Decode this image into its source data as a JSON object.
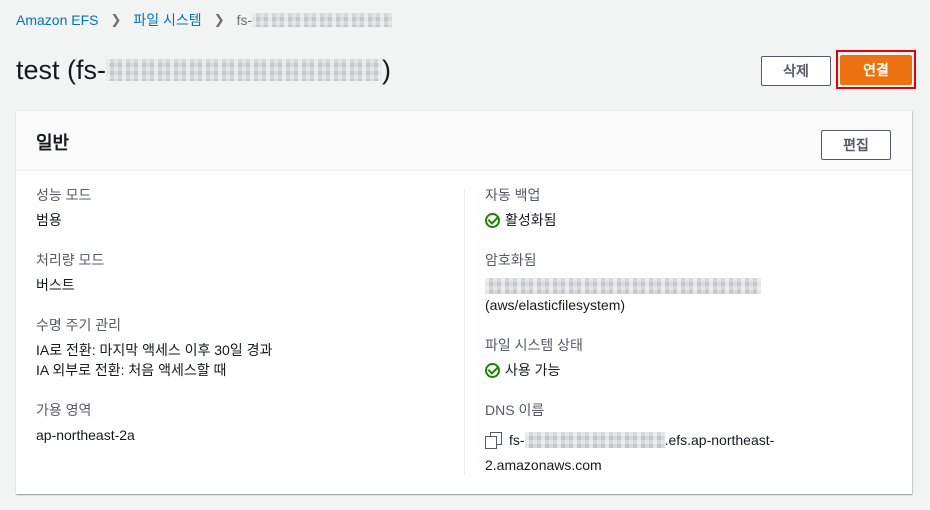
{
  "breadcrumb": {
    "items": [
      "Amazon EFS",
      "파일 시스템"
    ],
    "current": "fs-"
  },
  "title": {
    "prefix": "test (fs-",
    "suffix": ")"
  },
  "actions": {
    "delete": "삭제",
    "connect": "연결"
  },
  "panel": {
    "title": "일반",
    "edit": "편집"
  },
  "left": {
    "performance_label": "성능 모드",
    "performance_value": "범용",
    "throughput_label": "처리량 모드",
    "throughput_value": "버스트",
    "lifecycle_label": "수명 주기 관리",
    "lifecycle_line1": "IA로 전환: 마지막 액세스 이후 30일 경과",
    "lifecycle_line2": "IA 외부로 전환: 처음 액세스할 때",
    "az_label": "가용 영역",
    "az_value": "ap-northeast-2a"
  },
  "right": {
    "backup_label": "자동 백업",
    "backup_value": "활성화됨",
    "encrypted_label": "암호화됨",
    "encrypted_value": "(aws/elasticfilesystem)",
    "state_label": "파일 시스템 상태",
    "state_value": "사용 가능",
    "dns_label": "DNS 이름",
    "dns_prefix": "fs-",
    "dns_mid": ".efs.ap-northeast-",
    "dns_end": "2.amazonaws.com"
  },
  "icons": {
    "check": "check-circle-icon",
    "copy": "copy-icon",
    "chevron": "chevron-right-icon"
  },
  "colors": {
    "link": "#0073bb",
    "primary": "#ec7211",
    "success": "#1d8102",
    "highlight": "#e3000b"
  }
}
